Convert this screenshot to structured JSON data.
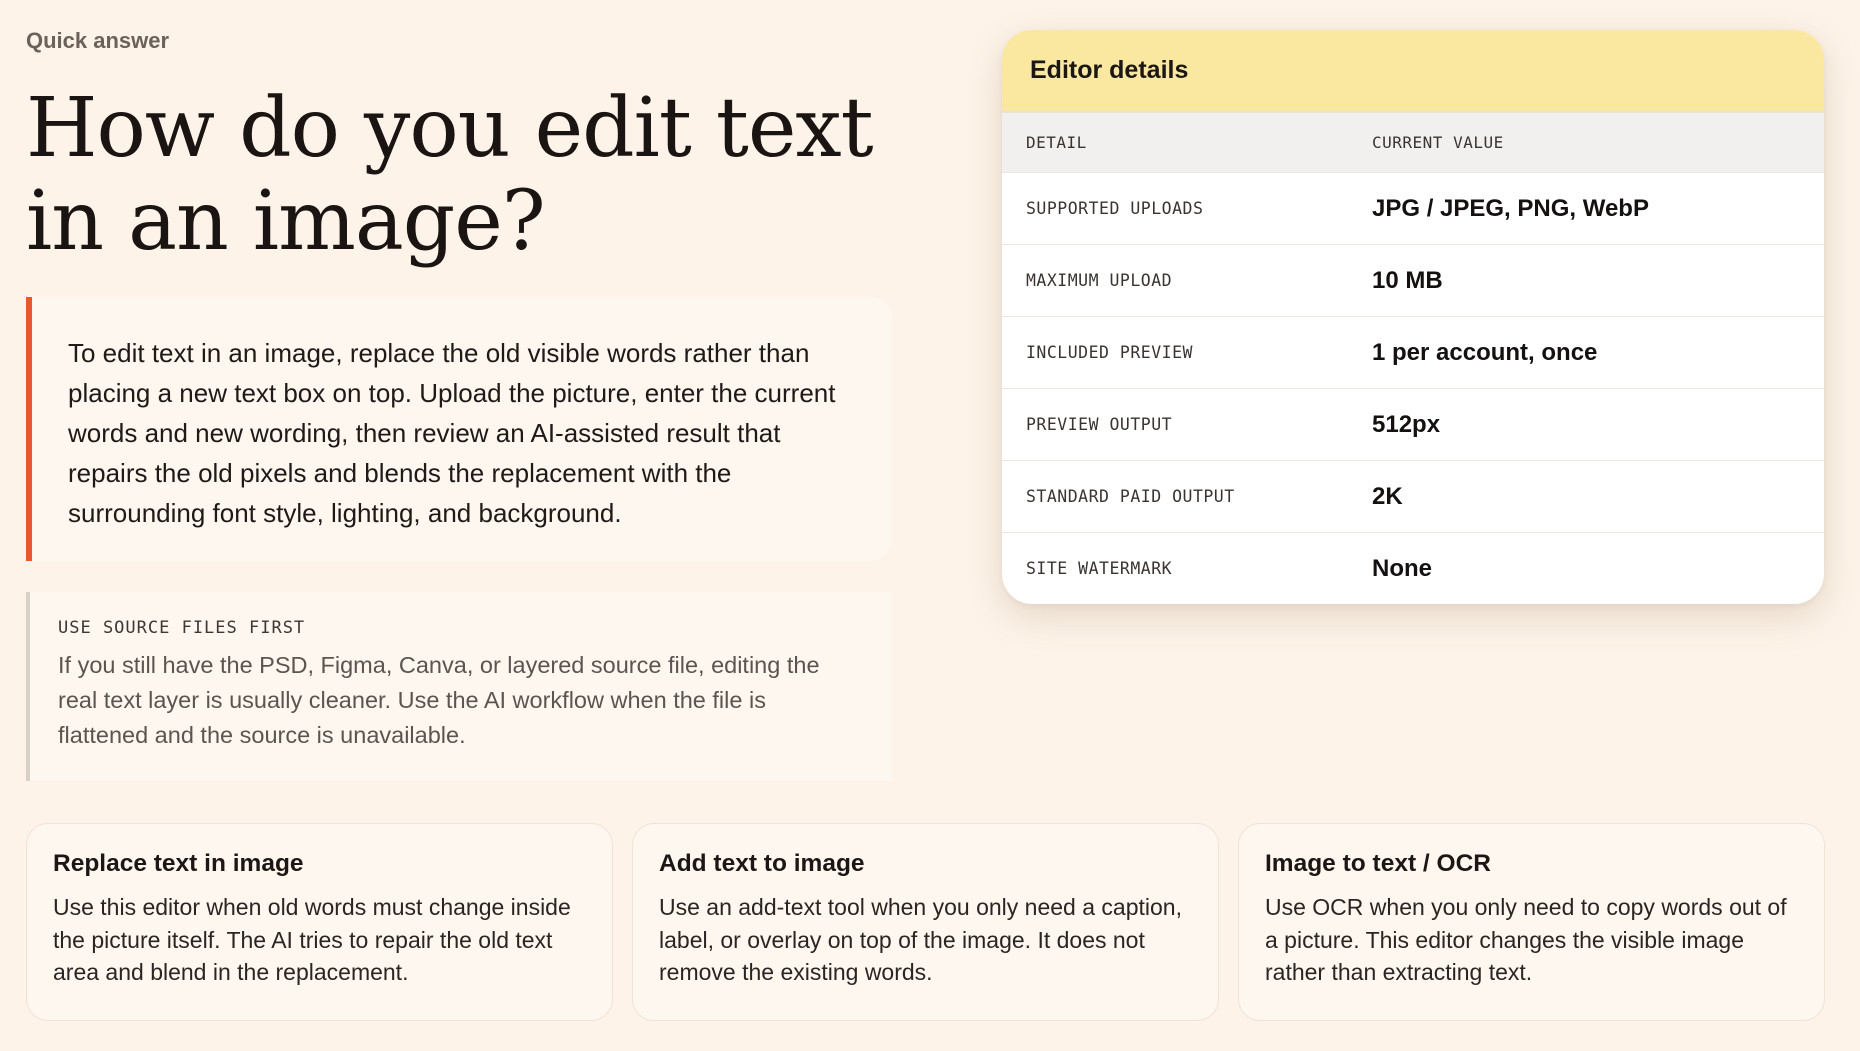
{
  "eyebrow": "Quick answer",
  "title": "How do you edit text in an image?",
  "answer": "To edit text in an image, replace the old visible words rather than placing a new text box on top. Upload the picture, enter the current words and new wording, then review an AI-assisted result that repairs the old pixels and blends the replacement with the surrounding font style, lighting, and background.",
  "note": {
    "title": "USE SOURCE FILES FIRST",
    "text": "If you still have the PSD, Figma, Canva, or layered source file, editing the real text layer is usually cleaner. Use the AI workflow when the file is flattened and the source is unavailable."
  },
  "details": {
    "title": "Editor details",
    "columns": [
      "DETAIL",
      "CURRENT VALUE"
    ],
    "rows": [
      {
        "key": "SUPPORTED UPLOADS",
        "value": "JPG / JPEG, PNG, WebP"
      },
      {
        "key": "MAXIMUM UPLOAD",
        "value": "10 MB"
      },
      {
        "key": "INCLUDED PREVIEW",
        "value": "1 per account, once"
      },
      {
        "key": "PREVIEW OUTPUT",
        "value": "512px"
      },
      {
        "key": "STANDARD PAID OUTPUT",
        "value": "2K"
      },
      {
        "key": "SITE WATERMARK",
        "value": "None"
      }
    ]
  },
  "cards": [
    {
      "title": "Replace text in image",
      "text": "Use this editor when old words must change inside the picture itself. The AI tries to repair the old text area and blend in the replacement."
    },
    {
      "title": "Add text to image",
      "text": "Use an add-text tool when you only need a caption, label, or overlay on top of the image. It does not remove the existing words."
    },
    {
      "title": "Image to text / OCR",
      "text": "Use OCR when you only need to copy words out of a picture. This editor changes the visible image rather than extracting text."
    }
  ],
  "colors": {
    "page_background": "#fdf3e8",
    "accent": "#e65a2a",
    "table_header_background": "#fae8a0"
  }
}
